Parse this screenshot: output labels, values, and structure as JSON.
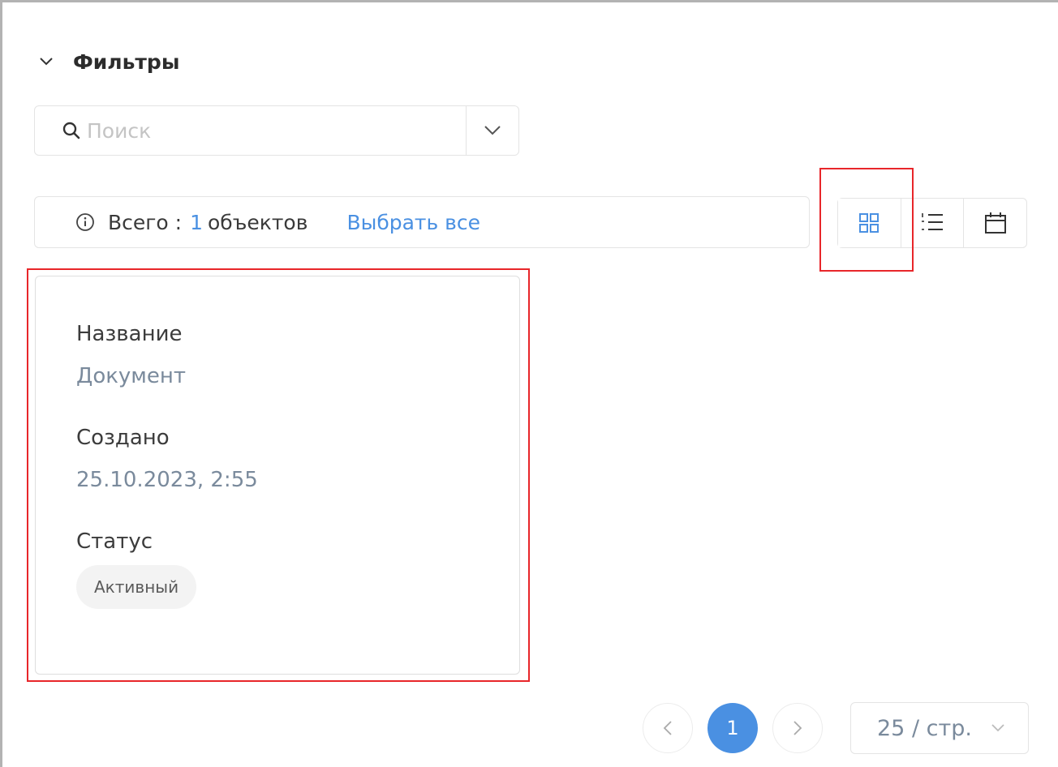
{
  "filters": {
    "title": "Фильтры"
  },
  "search": {
    "placeholder": "Поиск",
    "value": ""
  },
  "summary": {
    "total_label": "Всего :",
    "count": "1",
    "unit": "объектов",
    "select_all": "Выбрать все"
  },
  "view_switch": {
    "options": [
      "grid-icon",
      "list-icon",
      "calendar-icon"
    ],
    "active": "grid"
  },
  "card": {
    "fields": [
      {
        "label": "Название",
        "value": "Документ"
      },
      {
        "label": "Создано",
        "value": "25.10.2023, 2:55"
      }
    ],
    "status_label": "Статус",
    "status_value": "Активный"
  },
  "pagination": {
    "current": "1",
    "page_size": "25 / стр."
  },
  "colors": {
    "accent": "#4a90e2",
    "highlight": "#e8262a",
    "border": "#e4e4e4"
  }
}
